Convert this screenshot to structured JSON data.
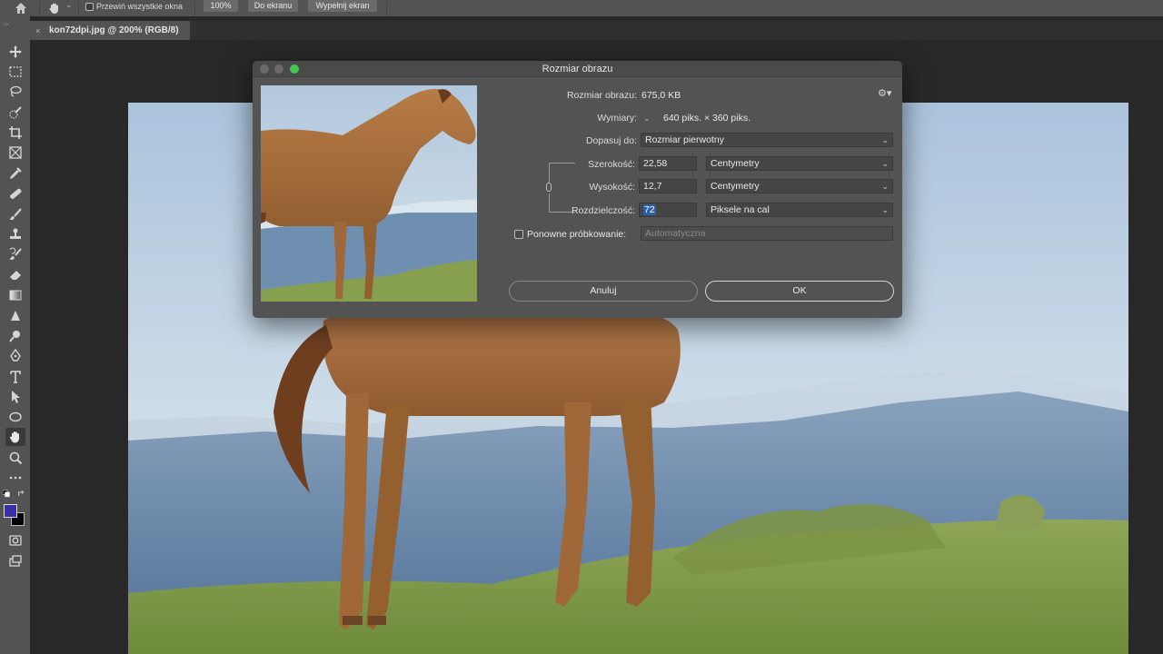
{
  "options_bar": {
    "scroll_all_label": "Przewiń wszystkie okna",
    "zoom_100": "100%",
    "fit_screen": "Do ekranu",
    "fill_screen": "Wypełnij ekran"
  },
  "document": {
    "tab_title": "kon72dpi.jpg @ 200% (RGB/8)",
    "close_glyph": "×"
  },
  "tools_panel": {
    "grip": "››",
    "colors": {
      "foreground": "#3a2fa8",
      "background": "#000000"
    }
  },
  "dialog": {
    "title": "Rozmiar obrazu",
    "image_size_label": "Rozmiar obrazu:",
    "image_size_value": "675,0 KB",
    "dimensions_label": "Wymiary:",
    "dimensions_value": "640 piks. × 360 piks.",
    "fit_to_label": "Dopasuj do:",
    "fit_to_value": "Rozmiar pierwotny",
    "width_label": "Szerokość:",
    "width_value": "22,58",
    "width_unit": "Centymetry",
    "height_label": "Wysokość:",
    "height_value": "12,7",
    "height_unit": "Centymetry",
    "resolution_label": "Rozdzielczość:",
    "resolution_value": "72",
    "resolution_unit": "Piksele na cal",
    "resample_label": "Ponowne próbkowanie:",
    "resample_value": "Automatyczna",
    "cancel_label": "Anuluj",
    "ok_label": "OK"
  },
  "colors": {
    "ui_panel": "#535353",
    "ui_dark": "#282828",
    "accent_selection": "#2f5ea8",
    "traffic_green": "#3fc650"
  }
}
